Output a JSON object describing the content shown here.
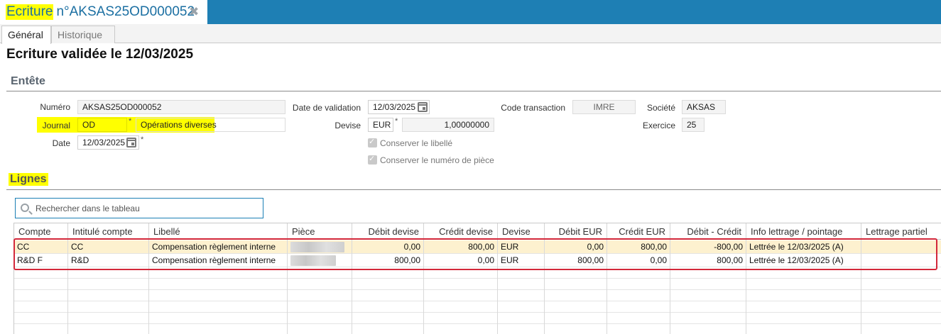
{
  "window": {
    "tab_highlight": "Ecriture",
    "tab_number": "n°AKSAS25OD000052",
    "close_glyph": "✖"
  },
  "subtabs": {
    "general": "Général",
    "historique": "Historique"
  },
  "page_title": "Ecriture validée le 12/03/2025",
  "entete": {
    "section": "Entête",
    "numero_label": "Numéro",
    "numero_value": "AKSAS25OD000052",
    "journal_label": "Journal",
    "journal_code": "OD",
    "journal_name": "Opérations diverses",
    "date_label": "Date",
    "date_value": "12/03/2025",
    "date_validation_label": "Date de validation",
    "date_validation_value": "12/03/2025",
    "devise_label": "Devise",
    "devise_code": "EUR",
    "devise_rate": "1,00000000",
    "conserver_libelle": "Conserver le libellé",
    "conserver_piece": "Conserver le numéro de pièce",
    "code_transaction_label": "Code transaction",
    "code_transaction_value": "IMRE",
    "societe_label": "Société",
    "societe_value": "AKSAS",
    "exercice_label": "Exercice",
    "exercice_value": "25",
    "required_mark": "*"
  },
  "lignes": {
    "section": "Lignes",
    "search_placeholder": "Rechercher dans le tableau",
    "columns": [
      "Compte",
      "Intitulé compte",
      "Libellé",
      "Pièce",
      "Débit devise",
      "Crédit devise",
      "Devise",
      "Débit EUR",
      "Crédit EUR",
      "Débit - Crédit",
      "Info lettrage / pointage",
      "Lettrage partiel"
    ],
    "rows": [
      [
        "CC",
        "CC",
        "Compensation règlement interne",
        "",
        "0,00",
        "800,00",
        "EUR",
        "0,00",
        "800,00",
        "-800,00",
        "Lettrée le 12/03/2025 (A)",
        ""
      ],
      [
        "R&D F",
        "R&D",
        "Compensation règlement interne",
        "",
        "800,00",
        "0,00",
        "EUR",
        "800,00",
        "0,00",
        "800,00",
        "Lettrée le 12/03/2025 (A)",
        ""
      ]
    ]
  },
  "colors": {
    "accent": "#1e7fb4",
    "highlight": "#ffff00",
    "selected_row": "#fdf1cf",
    "outline": "#d3283a"
  }
}
